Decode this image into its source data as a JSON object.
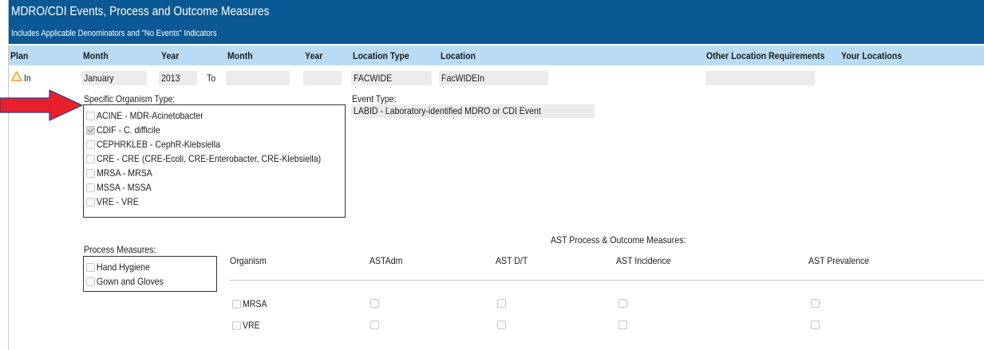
{
  "header": {
    "title": "MDRO/CDI Events, Process and Outcome Measures",
    "subtitle": "Includes Applicable Denominators and \"No Events\" Indicators"
  },
  "columns": {
    "plan": "Plan",
    "month1": "Month",
    "year1": "Year",
    "month2": "Month",
    "year2": "Year",
    "location_type": "Location Type",
    "location": "Location",
    "other_location_requirements": "Other Location Requirements",
    "your_locations": "Your Locations"
  },
  "row": {
    "plan": "In",
    "month1": "January",
    "year1": "2013",
    "to_label": "To",
    "month2": "",
    "year2": "",
    "location_type": "FACWIDE",
    "location": "FacWIDEIn",
    "other_location_requirements": ""
  },
  "organism_section": {
    "label": "Specific Organism Type:",
    "items": [
      {
        "label": "ACINE - MDR-Acinetobacter",
        "checked": false
      },
      {
        "label": "CDIF - C. difficile",
        "checked": true
      },
      {
        "label": "CEPHRKLEB - CephR-Klebsiella",
        "checked": false
      },
      {
        "label": "CRE - CRE (CRE-Ecoli, CRE-Enterobacter, CRE-Klebsiella)",
        "checked": false
      },
      {
        "label": "MRSA - MRSA",
        "checked": false
      },
      {
        "label": "MSSA - MSSA",
        "checked": false
      },
      {
        "label": "VRE - VRE",
        "checked": false
      }
    ]
  },
  "event_type": {
    "label": "Event Type:",
    "value": "LABID - Laboratory-identified MDRO or CDI Event"
  },
  "process_measures": {
    "label": "Process Measures:",
    "items": [
      {
        "label": "Hand Hygiene",
        "checked": false
      },
      {
        "label": "Gown and Gloves",
        "checked": false
      }
    ]
  },
  "ast": {
    "title": "AST Process & Outcome Measures:",
    "headers": [
      "Organism",
      "ASTAdm",
      "AST D/T",
      "AST Incidence",
      "AST Prevalence"
    ],
    "rows": [
      {
        "organism": "MRSA"
      },
      {
        "organism": "VRE"
      }
    ]
  },
  "colors": {
    "title_bg": "#0a5894",
    "header_row_bg": "#b9dcf4",
    "arrow": "#e8202a",
    "warning": "#f0a020"
  },
  "icons": {
    "plan_status": "warning-triangle-icon",
    "pointer": "red-arrow-icon"
  }
}
